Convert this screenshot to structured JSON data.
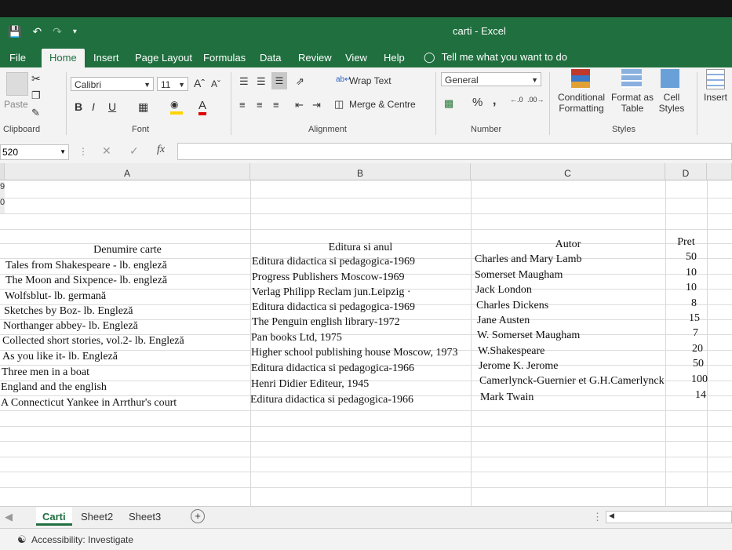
{
  "window": {
    "title": "carti  -  Excel"
  },
  "menu": {
    "tabs": [
      "File",
      "Home",
      "Insert",
      "Page Layout",
      "Formulas",
      "Data",
      "Review",
      "View",
      "Help"
    ],
    "tell_me": "Tell me what you want to do"
  },
  "ribbon": {
    "clipboard": {
      "paste": "Paste",
      "label": "Clipboard"
    },
    "font": {
      "name": "Calibri",
      "size": "11",
      "label": "Font",
      "bold": "B",
      "italic": "I",
      "underline": "U"
    },
    "alignment": {
      "wrap_text": "Wrap Text",
      "merge_centre": "Merge & Centre",
      "label": "Alignment"
    },
    "number": {
      "format": "General",
      "percent": "%",
      "comma": ",",
      "label": "Number"
    },
    "styles": {
      "conditional_line1": "Conditional",
      "conditional_line2": "Formatting",
      "format_as_line1": "Format as",
      "format_as_line2": "Table",
      "cell_styles_line1": "Cell",
      "cell_styles_line2": "Styles",
      "label": "Styles"
    },
    "cells": {
      "insert": "Insert"
    }
  },
  "formula_bar": {
    "name_box": "520",
    "fx": "fx",
    "content": ""
  },
  "columns": [
    "A",
    "B",
    "C",
    "D"
  ],
  "row_headers": [
    "9",
    "0"
  ],
  "table": {
    "headers": [
      "Denumire carte",
      "Editura si anul",
      "Autor",
      "Pret"
    ],
    "rows": [
      [
        "Tales from Shakespeare - lb. engleză",
        "Editura didactica si pedagogica-1969",
        "Charles and Mary Lamb",
        "50"
      ],
      [
        "The Moon and Sixpence- lb. engleză",
        "Progress Publishers Moscow-1969",
        "Somerset Maugham",
        "10"
      ],
      [
        "Wolfsblut- lb. germană",
        "Verlag Philipp Reclam jun.Leipzig ·",
        "Jack London",
        "10"
      ],
      [
        "Sketches by Boz- lb. Engleză",
        "Editura didactica si pedagogica-1969",
        "Charles Dickens",
        "8"
      ],
      [
        "Northanger abbey- lb. Engleză",
        "The Penguin english library-1972",
        "Jane Austen",
        "15"
      ],
      [
        "Collected short stories, vol.2- lb. Engleză",
        "Pan books Ltd, 1975",
        "W. Somerset Maugham",
        "7"
      ],
      [
        "As you like it- lb. Engleză",
        "Higher school publishing house  Moscow, 1973",
        "W.Shakespeare",
        "20"
      ],
      [
        "Three men in a boat",
        "Editura didactica si pedagogica-1966",
        "Jerome K. Jerome",
        "50"
      ],
      [
        "England and the english",
        "Henri Didier Editeur, 1945",
        "Camerlynck-Guernier et G.H.Camerlynck",
        "100"
      ],
      [
        "A Connecticut Yankee in Arrthur's court",
        "Editura didactica si pedagogica-1966",
        "Mark Twain",
        "14"
      ]
    ]
  },
  "sheets": {
    "tabs": [
      "Carti",
      "Sheet2",
      "Sheet3"
    ],
    "add": "+"
  },
  "status": {
    "accessibility": "Accessibility: Investigate"
  },
  "colors": {
    "excel_green": "#1f6f3f",
    "ribbon_bg": "#f3f3f3"
  }
}
